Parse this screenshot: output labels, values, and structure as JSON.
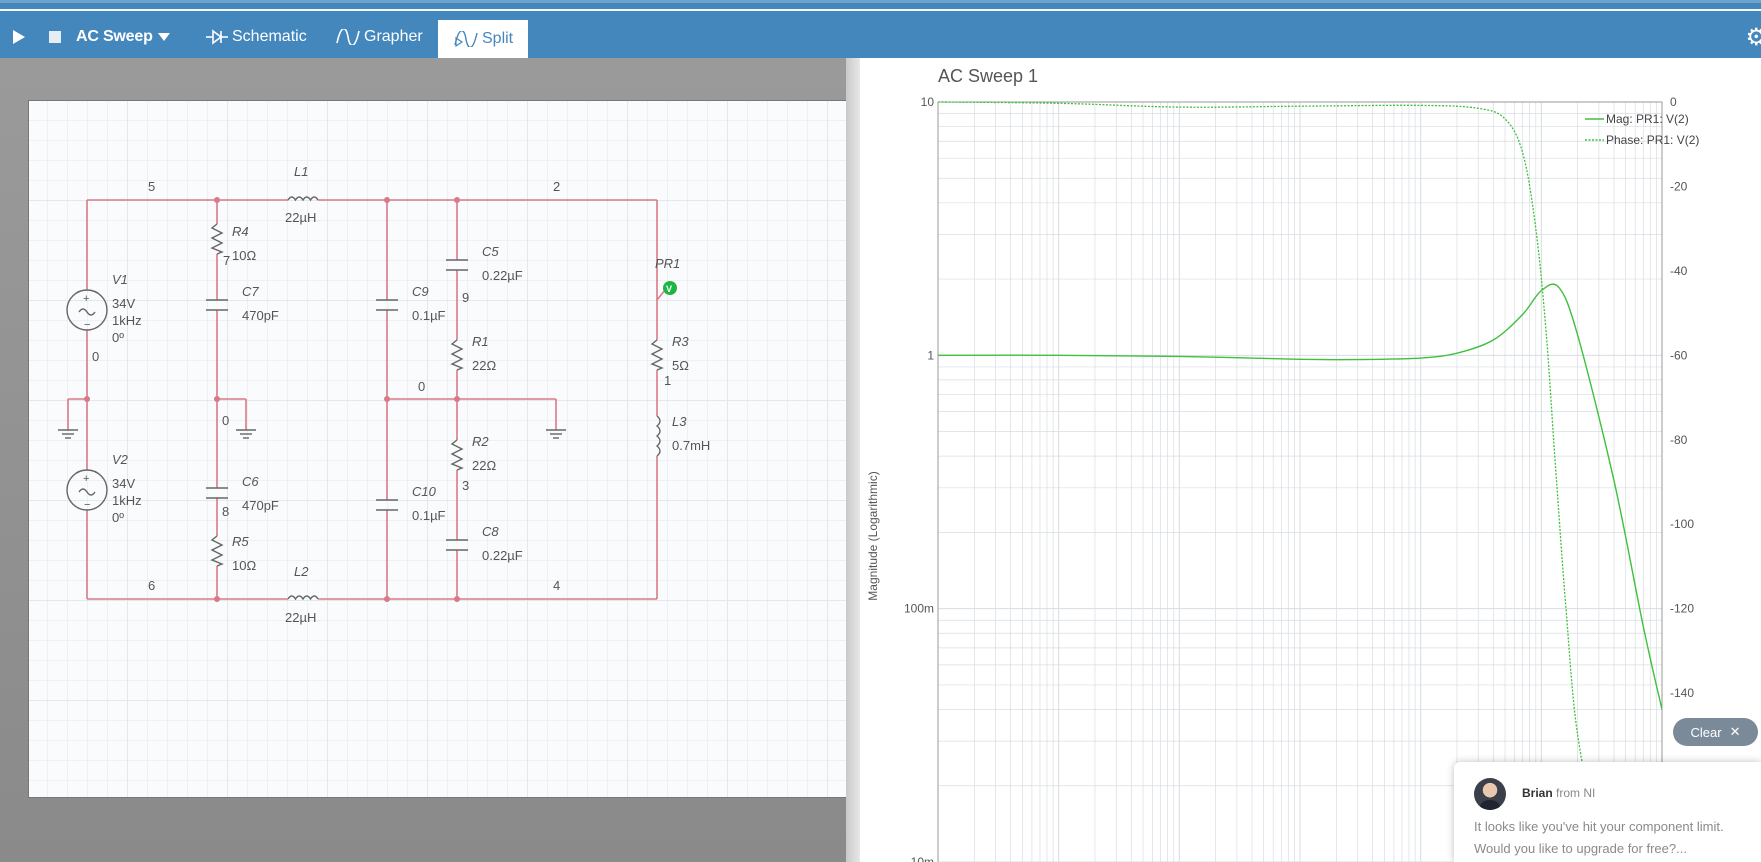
{
  "toolbar": {
    "simulation_name": "AC Sweep",
    "tabs": [
      {
        "label": "Schematic",
        "active": false
      },
      {
        "label": "Grapher",
        "active": false
      },
      {
        "label": "Split",
        "active": true
      }
    ],
    "icons": [
      "play-icon",
      "stop-icon",
      "caret-down-icon",
      "schematic-icon",
      "grapher-icon",
      "split-icon",
      "gear-icon"
    ]
  },
  "schematic": {
    "nodes": [
      "5",
      "2",
      "7",
      "9",
      "0",
      "0",
      "0",
      "1",
      "8",
      "3",
      "6",
      "4",
      "0"
    ],
    "components": [
      {
        "ref": "L1",
        "value": "22µH"
      },
      {
        "ref": "R4",
        "value": "10Ω"
      },
      {
        "ref": "C7",
        "value": "470pF"
      },
      {
        "ref": "V1",
        "value": "34V",
        "freq": "1kHz",
        "phase": "0º"
      },
      {
        "ref": "C9",
        "value": "0.1µF"
      },
      {
        "ref": "C5",
        "value": "0.22µF"
      },
      {
        "ref": "R1",
        "value": "22Ω"
      },
      {
        "ref": "PR1",
        "value": ""
      },
      {
        "ref": "R3",
        "value": "5Ω"
      },
      {
        "ref": "L3",
        "value": "0.7mH"
      },
      {
        "ref": "V2",
        "value": "34V",
        "freq": "1kHz",
        "phase": "0º"
      },
      {
        "ref": "C6",
        "value": "470pF"
      },
      {
        "ref": "R5",
        "value": "10Ω"
      },
      {
        "ref": "R2",
        "value": "22Ω"
      },
      {
        "ref": "C10",
        "value": "0.1µF"
      },
      {
        "ref": "C8",
        "value": "0.22µF"
      },
      {
        "ref": "L2",
        "value": "22µH"
      }
    ],
    "probe_badge": "V"
  },
  "chart_data": {
    "type": "line",
    "title": "AC Sweep 1",
    "ylabel": "Magnitude (Logarithmic)",
    "y_scale": "log",
    "ylim": [
      0.01,
      10
    ],
    "yticks": [
      "10",
      "1",
      "100m",
      "10m"
    ],
    "y2lim": [
      -180,
      0
    ],
    "y2ticks": [
      "0",
      "-20",
      "-40",
      "-60",
      "-80",
      "-100",
      "-120",
      "-140"
    ],
    "x_scale": "log",
    "xlim": [
      1,
      1000000
    ],
    "grid": true,
    "legend_position": "top-right",
    "series": [
      {
        "name": "Mag: PR1: V(2)",
        "axis": "left",
        "style": "solid",
        "x": [
          1,
          10,
          100,
          1000,
          3000,
          10000,
          20000,
          40000,
          70000,
          100000,
          140000,
          200000,
          400000,
          700000,
          1000000
        ],
        "values": [
          1.0,
          1.0,
          0.99,
          0.965,
          0.962,
          0.975,
          1.02,
          1.15,
          1.45,
          1.8,
          1.85,
          1.2,
          0.32,
          0.085,
          0.04
        ]
      },
      {
        "name": "Phase: PR1: V(2)",
        "axis": "right",
        "style": "dotted",
        "x": [
          1,
          10,
          100,
          1000,
          10000,
          30000,
          50000,
          70000,
          90000,
          110000,
          130000,
          160000,
          200000,
          300000,
          500000
        ],
        "values": [
          0,
          -0.3,
          -1.2,
          -1.0,
          -0.8,
          -1.5,
          -4,
          -12,
          -30,
          -55,
          -85,
          -120,
          -150,
          -172,
          -178
        ]
      }
    ],
    "colors": {
      "series": "#3fc03f",
      "grid": "#d8dde2",
      "axis": "#999999"
    }
  },
  "graph_controls": {
    "clear_label": "Clear"
  },
  "chat": {
    "agent_name": "Brian",
    "agent_from": "from NI",
    "message": "It looks like you've hit your component limit. Would you like to upgrade for free?..."
  }
}
